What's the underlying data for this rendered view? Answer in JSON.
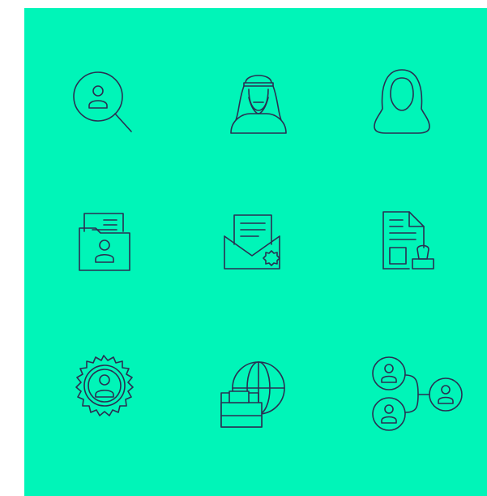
{
  "theme": {
    "background": "#00f5b8",
    "stroke": "#2a2f52",
    "page_background": "#ffffff"
  },
  "icons": [
    "user-search-icon",
    "arab-man-icon",
    "hijab-woman-icon",
    "user-folder-icon",
    "certified-envelope-icon",
    "document-stamp-icon",
    "user-gear-icon",
    "global-business-icon",
    "user-network-icon"
  ]
}
